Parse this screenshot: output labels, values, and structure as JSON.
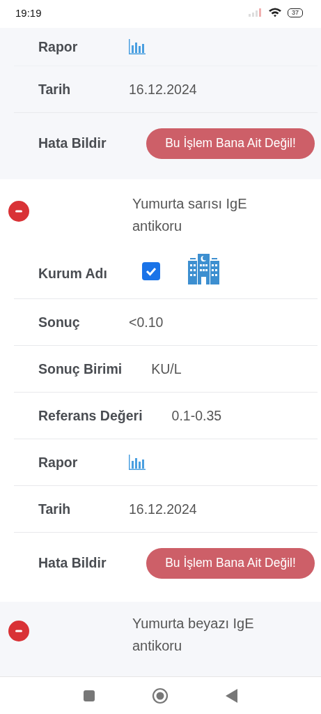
{
  "status_bar": {
    "time": "19:19",
    "battery": "37"
  },
  "tests": [
    {
      "rows": [
        {
          "kind": "report",
          "label": "Rapor"
        },
        {
          "kind": "text",
          "label": "Tarih",
          "value": "16.12.2024"
        },
        {
          "kind": "action",
          "label": "Hata Bildir",
          "button": "Bu İşlem Bana Ait Değil!"
        }
      ]
    },
    {
      "name": "Yumurta sarısı IgE antikoru",
      "expanded": true,
      "rows": [
        {
          "kind": "checkbox",
          "label": "Kurum Adı",
          "checked": true
        },
        {
          "kind": "text",
          "label": "Sonuç",
          "value": "<0.10"
        },
        {
          "kind": "text",
          "label": "Sonuç Birimi",
          "value": "KU/L"
        },
        {
          "kind": "text",
          "label": "Referans Değeri",
          "value": "0.1-0.35"
        },
        {
          "kind": "report",
          "label": "Rapor"
        },
        {
          "kind": "text",
          "label": "Tarih",
          "value": "16.12.2024"
        },
        {
          "kind": "action",
          "label": "Hata Bildir",
          "button": "Bu İşlem Bana Ait Değil!"
        }
      ]
    },
    {
      "name": "Yumurta beyazı IgE antikoru",
      "expanded": true
    }
  ]
}
